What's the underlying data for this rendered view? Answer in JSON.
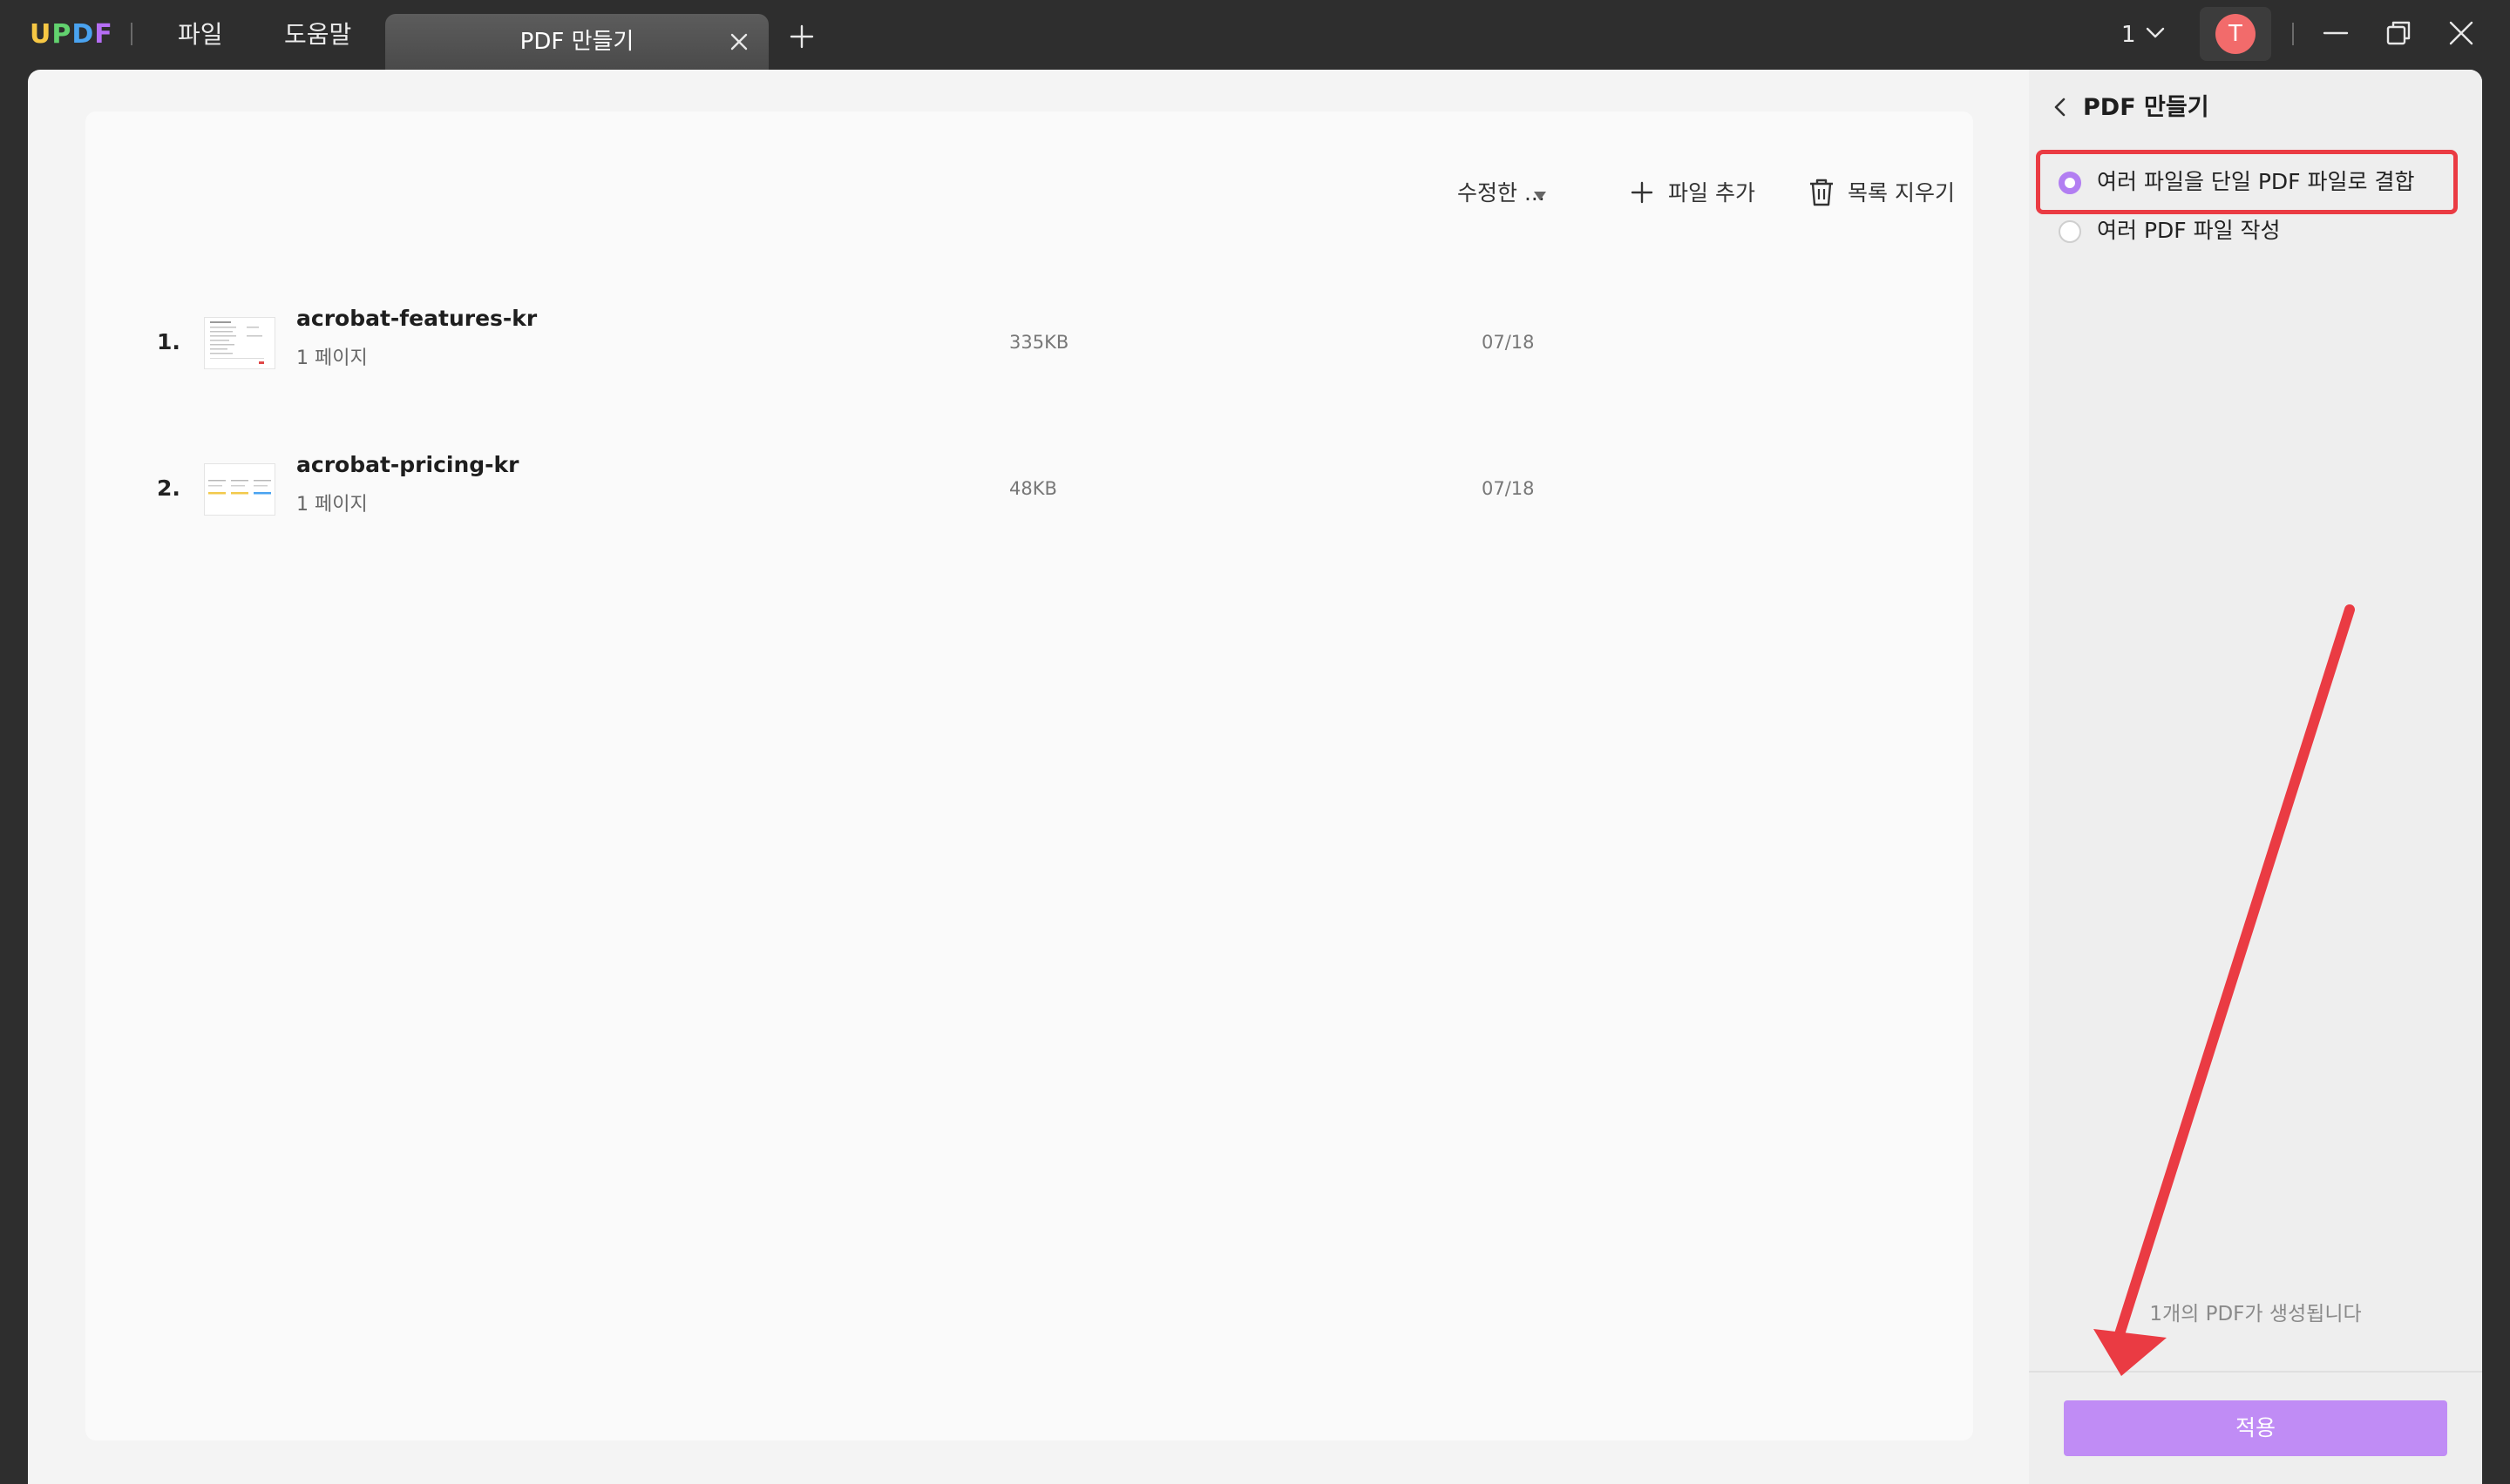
{
  "titlebar": {
    "logo_letters": [
      "U",
      "P",
      "D",
      "F"
    ],
    "menu": {
      "file": "파일",
      "help": "도움말"
    },
    "tab": {
      "label": "PDF 만들기"
    },
    "page_count": "1",
    "avatar_letter": "T"
  },
  "toolbar": {
    "sort_label": "수정한 ...",
    "add_file": "파일 추가",
    "clear_list": "목록 지우기"
  },
  "files": [
    {
      "index": "1.",
      "name": "acrobat-features-kr",
      "pages": "1 페이지",
      "size": "335KB",
      "date": "07/18"
    },
    {
      "index": "2.",
      "name": "acrobat-pricing-kr",
      "pages": "1 페이지",
      "size": "48KB",
      "date": "07/18"
    }
  ],
  "right_panel": {
    "title": "PDF 만들기",
    "options": [
      {
        "label": "여러 파일을 단일 PDF 파일로 결합",
        "selected": true
      },
      {
        "label": "여러 PDF 파일 작성",
        "selected": false
      }
    ],
    "info": "1개의 PDF가 생성됩니다",
    "apply": "적용"
  },
  "colors": {
    "accent": "#c08cf5",
    "radio_selected": "#b27ef2",
    "highlight_box": "#ea3b43",
    "avatar": "#f26b6b",
    "titlebar_bg": "#2e2e2e"
  }
}
